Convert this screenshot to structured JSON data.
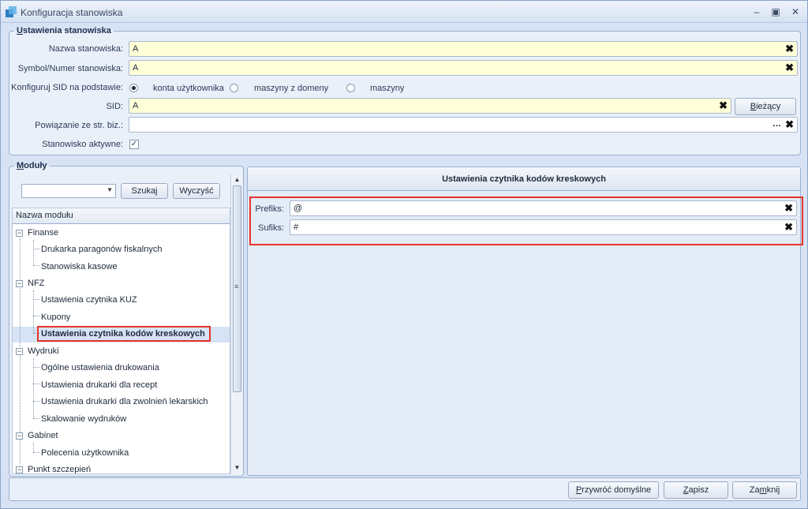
{
  "window": {
    "title": "Konfiguracja stanowiska"
  },
  "settings": {
    "group_title_prefix": "U",
    "group_title_rest": "stawienia stanowiska",
    "name_label": "Nazwa stanowiska:",
    "name_value": "A",
    "symbol_label": "Symbol/Numer stanowiska:",
    "symbol_value": "A",
    "sid_basis_label": "Konfiguruj SID na podstawie:",
    "sid_options": [
      "konta użytkownika",
      "maszyny z domeny",
      "maszyny"
    ],
    "sid_selected": "konta użytkownika",
    "sid_label": "SID:",
    "sid_value": "A",
    "current_button_prefix": "B",
    "current_button_rest": "ieżący",
    "link_label": "Powiązanie ze str. biz.:",
    "link_value": "",
    "active_label": "Stanowisko aktywne:",
    "active_checked": true
  },
  "modules": {
    "group_title_prefix": "M",
    "group_title_rest": "oduły",
    "search_value": "",
    "search_button": "Szukaj",
    "clear_button_prefix": "Wyczyść",
    "column_header": "Nazwa modułu",
    "tree": [
      {
        "label": "Finanse",
        "children": [
          "Drukarka paragonów fiskalnych",
          "Stanowiska kasowe"
        ]
      },
      {
        "label": "NFZ",
        "children": [
          "Ustawienia czytnika KUZ",
          "Kupony",
          "Ustawienia czytnika kodów kreskowych"
        ]
      },
      {
        "label": "Wydruki",
        "children": [
          "Ogólne ustawienia drukowania",
          "Ustawienia drukarki dla recept",
          "Ustawienia drukarki dla zwolnień lekarskich",
          "Skalowanie wydruków"
        ]
      },
      {
        "label": "Gabinet",
        "children": [
          "Polecenia użytkownika"
        ]
      },
      {
        "label": "Punkt szczepień",
        "children": []
      }
    ],
    "selected": "Ustawienia czytnika kodów kreskowych"
  },
  "panel": {
    "title": "Ustawienia czytnika kodów kreskowych",
    "prefix_label": "Prefiks:",
    "prefix_value": "@",
    "suffix_label": "Sufiks:",
    "suffix_value": "#"
  },
  "footer": {
    "restore_prefix": "P",
    "restore_rest": "rzywróć domyślne",
    "save_prefix": "Z",
    "save_rest": "apisz",
    "close_prefix": "Za",
    "close_mid": "m",
    "close_rest": "knij"
  },
  "colors": {
    "highlight": "#e8332b",
    "field_yellow": "#ffffd8",
    "window_bg": "#d7e3f4"
  }
}
